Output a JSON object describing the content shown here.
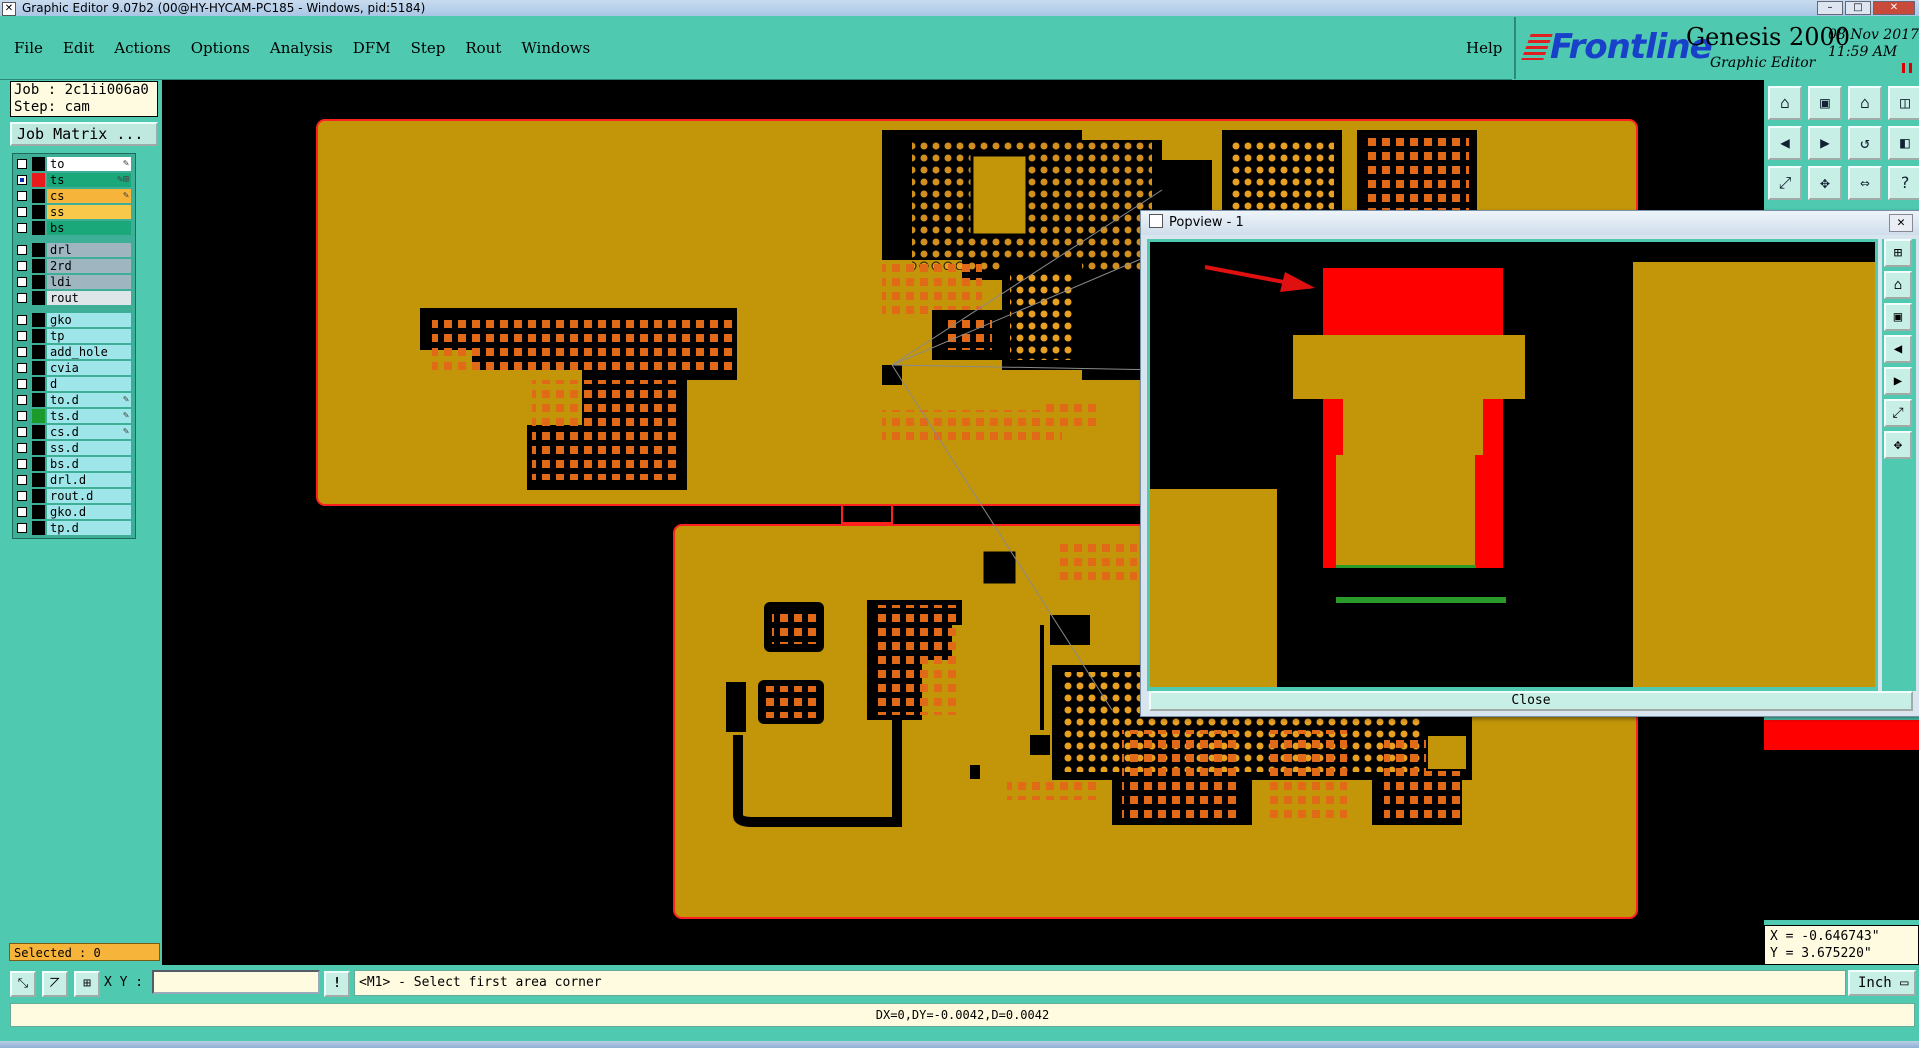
{
  "window": {
    "title": "Graphic Editor 9.07b2 (00@HY-HYCAM-PC185 - Windows, pid:5184)",
    "controls": [
      "–",
      "□",
      "✕"
    ]
  },
  "menu": {
    "items": [
      "File",
      "Edit",
      "Actions",
      "Options",
      "Analysis",
      "DFM",
      "Step",
      "Rout",
      "Windows"
    ],
    "help": "Help"
  },
  "brand": {
    "logo": "Frontline",
    "product": "Genesis 2000",
    "subtitle": "Graphic Editor",
    "date": "08 Nov 2017",
    "time": "11:59 AM"
  },
  "job": {
    "job_line": "Job : 2c1ii006a0",
    "step_line": "Step: cam",
    "matrix_button": "Job Matrix ..."
  },
  "layers": {
    "group1": [
      {
        "name": "to",
        "color": "#ffffff",
        "swatch": "#000000",
        "checked": false,
        "mark": "✎"
      },
      {
        "name": "ts",
        "color": "#1aa87a",
        "swatch": "#e81c1c",
        "checked": true,
        "mark": "✎⊞"
      },
      {
        "name": "cs",
        "color": "#f7b43b",
        "swatch": "#000000",
        "checked": false,
        "mark": "✎"
      },
      {
        "name": "ss",
        "color": "#f7c84a",
        "swatch": "#000000",
        "checked": false,
        "mark": ""
      },
      {
        "name": "bs",
        "color": "#1aa87a",
        "swatch": "#000000",
        "checked": false,
        "mark": ""
      }
    ],
    "group2": [
      {
        "name": "drl",
        "color": "#9fb6c0",
        "swatch": "#000000",
        "checked": false,
        "mark": ""
      },
      {
        "name": "2rd",
        "color": "#9fb6c0",
        "swatch": "#000000",
        "checked": false,
        "mark": ""
      },
      {
        "name": "ldi",
        "color": "#9fb6c0",
        "swatch": "#000000",
        "checked": false,
        "mark": ""
      },
      {
        "name": "rout",
        "color": "#dfe6ea",
        "swatch": "#000000",
        "checked": false,
        "mark": ""
      }
    ],
    "group3": [
      {
        "name": "gko",
        "color": "#9ee6ea",
        "swatch": "#000000",
        "checked": false,
        "mark": ""
      },
      {
        "name": "tp",
        "color": "#9ee6ea",
        "swatch": "#000000",
        "checked": false,
        "mark": ""
      },
      {
        "name": "add_hole",
        "color": "#9ee6ea",
        "swatch": "#000000",
        "checked": false,
        "mark": ""
      },
      {
        "name": "cvia",
        "color": "#9ee6ea",
        "swatch": "#000000",
        "checked": false,
        "mark": ""
      },
      {
        "name": "d",
        "color": "#9ee6ea",
        "swatch": "#000000",
        "checked": false,
        "mark": ""
      },
      {
        "name": "to.d",
        "color": "#9ee6ea",
        "swatch": "#000000",
        "checked": false,
        "mark": "✎"
      },
      {
        "name": "ts.d",
        "color": "#9ee6ea",
        "swatch": "#1c9a2a",
        "checked": false,
        "mark": "✎"
      },
      {
        "name": "cs.d",
        "color": "#9ee6ea",
        "swatch": "#000000",
        "checked": false,
        "mark": "✎"
      },
      {
        "name": "ss.d",
        "color": "#9ee6ea",
        "swatch": "#000000",
        "checked": false,
        "mark": ""
      },
      {
        "name": "bs.d",
        "color": "#9ee6ea",
        "swatch": "#000000",
        "checked": false,
        "mark": ""
      },
      {
        "name": "drl.d",
        "color": "#9ee6ea",
        "swatch": "#000000",
        "checked": false,
        "mark": ""
      },
      {
        "name": "rout.d",
        "color": "#9ee6ea",
        "swatch": "#000000",
        "checked": false,
        "mark": ""
      },
      {
        "name": "gko.d",
        "color": "#9ee6ea",
        "swatch": "#000000",
        "checked": false,
        "mark": ""
      },
      {
        "name": "tp.d",
        "color": "#9ee6ea",
        "swatch": "#000000",
        "checked": false,
        "mark": ""
      }
    ]
  },
  "status": {
    "selected": "Selected : 0"
  },
  "popview": {
    "title": "Popview - 1",
    "close_label": "Close",
    "close_x": "✕"
  },
  "coords": {
    "x": "X = -0.646743\"",
    "y": "Y = 3.675220\""
  },
  "command": {
    "xy_label": "X Y :",
    "xy_value": "",
    "warn": "!",
    "prompt": "<M1> - Select first area corner",
    "unit": "Inch"
  },
  "measure": "DX=0,DY=-0.0042,D=0.0042",
  "right_toolbar_icons": [
    "home-icon",
    "save-icon",
    "house-icon",
    "zoom-window-icon",
    "prev-icon",
    "next-icon",
    "undo-icon",
    "panel-icon",
    "fit-icon",
    "center-icon",
    "ratio-icon",
    "help-icon"
  ],
  "colors": {
    "board": "#c3960a",
    "pad_red": "#ff0000",
    "panel": "#4fc9b0",
    "background": "#000000"
  }
}
